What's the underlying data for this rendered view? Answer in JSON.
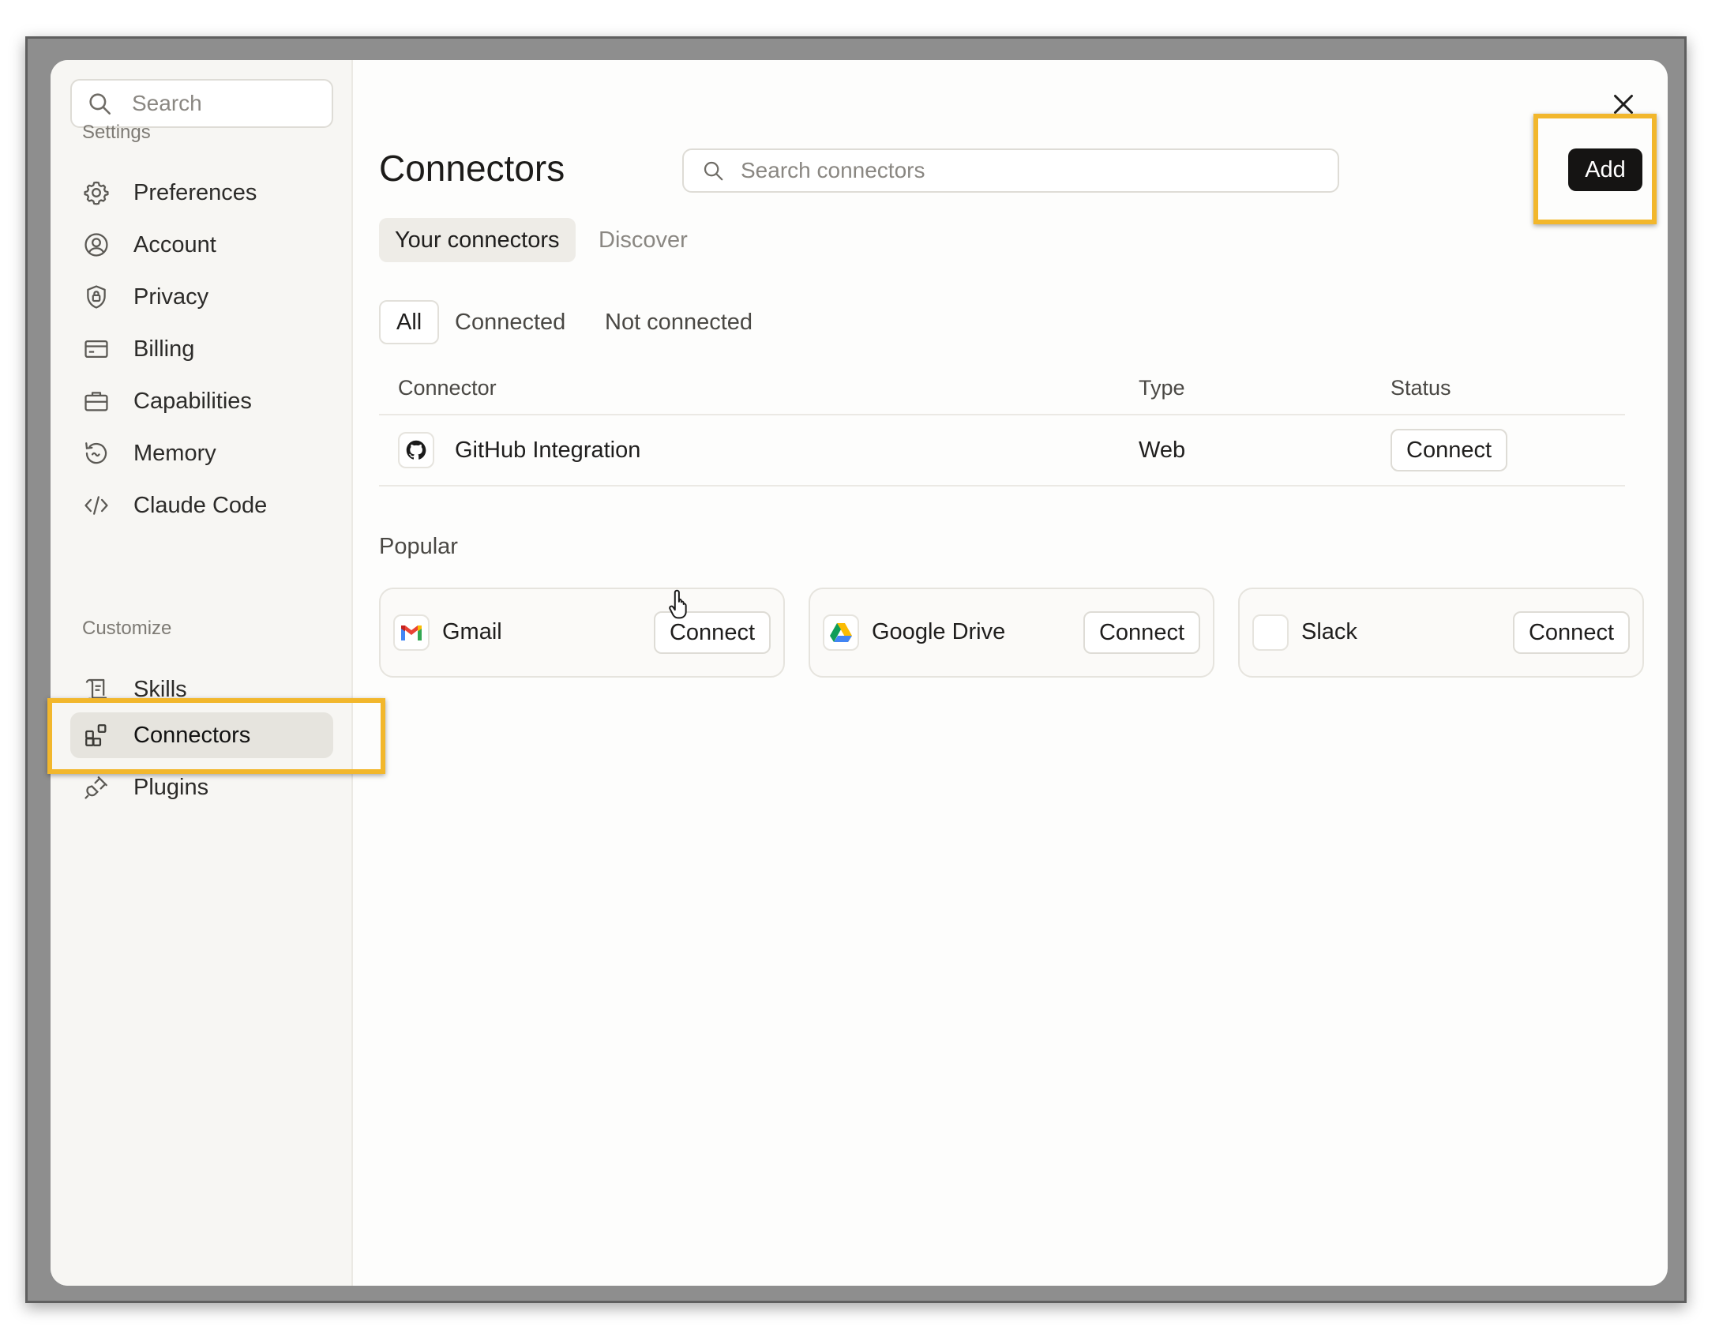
{
  "sidebar": {
    "search_placeholder": "Search",
    "settings_label": "Settings",
    "settings_items": [
      {
        "label": "Preferences",
        "icon": "gear-icon"
      },
      {
        "label": "Account",
        "icon": "user-circle-icon"
      },
      {
        "label": "Privacy",
        "icon": "shield-lock-icon"
      },
      {
        "label": "Billing",
        "icon": "credit-card-icon"
      },
      {
        "label": "Capabilities",
        "icon": "briefcase-icon"
      },
      {
        "label": "Memory",
        "icon": "history-icon"
      },
      {
        "label": "Claude Code",
        "icon": "code-icon"
      }
    ],
    "customize_label": "Customize",
    "customize_items": [
      {
        "label": "Skills",
        "icon": "scroll-icon"
      },
      {
        "label": "Connectors",
        "icon": "connectors-grid-icon",
        "active": true
      },
      {
        "label": "Plugins",
        "icon": "plug-icon"
      }
    ]
  },
  "main": {
    "title": "Connectors",
    "search_placeholder": "Search connectors",
    "add_label": "Add",
    "tabs": [
      {
        "label": "Your connectors",
        "active": true
      },
      {
        "label": "Discover",
        "active": false
      }
    ],
    "filters": [
      {
        "label": "All",
        "active": true
      },
      {
        "label": "Connected",
        "active": false
      },
      {
        "label": "Not connected",
        "active": false
      }
    ],
    "table": {
      "columns": [
        "Connector",
        "Type",
        "Status"
      ],
      "rows": [
        {
          "name": "GitHub Integration",
          "icon": "github-icon",
          "type": "Web",
          "action": "Connect"
        }
      ]
    },
    "popular_label": "Popular",
    "popular": [
      {
        "name": "Gmail",
        "icon": "gmail-icon",
        "action": "Connect"
      },
      {
        "name": "Google Drive",
        "icon": "google-drive-icon",
        "action": "Connect"
      },
      {
        "name": "Slack",
        "icon": "slack-icon",
        "action": "Connect"
      }
    ]
  },
  "colors": {
    "highlight": "#f2b72c",
    "add_button_bg": "#151413",
    "sidebar_bg": "#f7f6f3"
  }
}
